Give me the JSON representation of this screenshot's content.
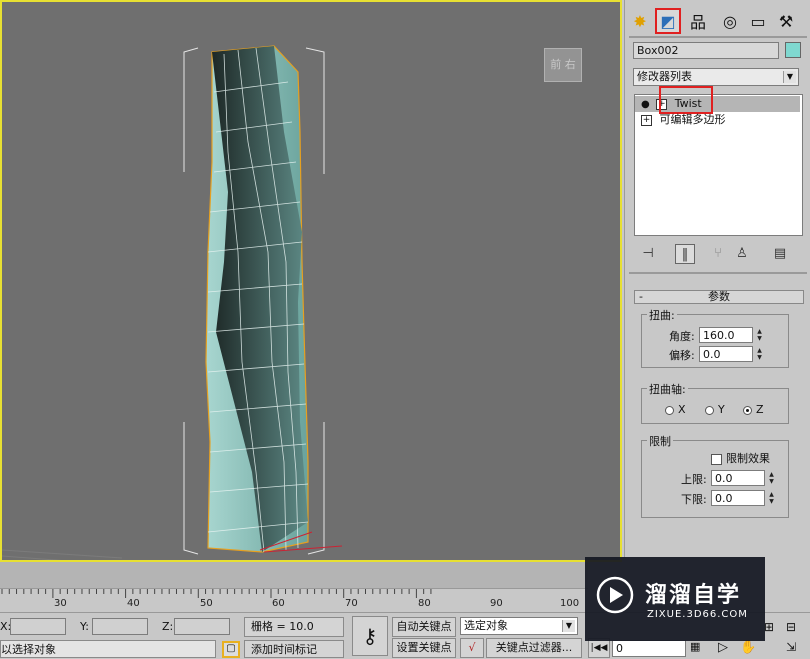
{
  "viewport": {
    "viewcube_label": "前 右"
  },
  "panel": {
    "tabs": [
      {
        "name": "create",
        "glyph": "✸"
      },
      {
        "name": "modify",
        "glyph": "◩"
      },
      {
        "name": "hierarchy",
        "glyph": "品"
      },
      {
        "name": "motion",
        "glyph": "◎"
      },
      {
        "name": "display",
        "glyph": "▭"
      },
      {
        "name": "utilities",
        "glyph": "⚒"
      }
    ],
    "object_name": "Box002",
    "object_color": "#7fd8d0",
    "modifier_list": "修改器列表",
    "stack": [
      {
        "label": "Twist"
      },
      {
        "label": "可编辑多边形"
      }
    ],
    "params": {
      "rollout_title": "参数",
      "rollout_collapse": "-",
      "twist_group": "扭曲:",
      "angle_label": "角度:",
      "angle_value": "160.0",
      "bias_label": "偏移:",
      "bias_value": "0.0",
      "axis_group": "扭曲轴:",
      "axis_x": "X",
      "axis_y": "Y",
      "axis_z": "Z",
      "limit_group": "限制",
      "limit_effect": "限制效果",
      "upper_label": "上限:",
      "upper_value": "0.0",
      "lower_label": "下限:",
      "lower_value": "0.0"
    }
  },
  "timeline": {
    "ticks": [
      "30",
      "40",
      "50",
      "60",
      "70",
      "80",
      "90",
      "100"
    ]
  },
  "status": {
    "x_label": "X:",
    "y_label": "Y:",
    "z_label": "Z:",
    "grid": "栅格 = 10.0",
    "auto_key": "自动关键点",
    "selected": "选定对象",
    "set_key": "设置关键点",
    "key_filter": "关键点过滤器...",
    "frame": "0",
    "prompt": "以选择对象",
    "add_time_tag": "添加时间标记"
  },
  "watermark": {
    "title": "溜溜自学",
    "url": "ZIXUE.3D66.COM"
  }
}
